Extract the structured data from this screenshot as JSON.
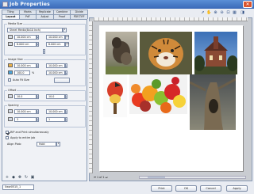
{
  "window": {
    "title": "Job Properties"
  },
  "tabs": {
    "row1": [
      "Tiling",
      "Marks",
      "Replicate",
      "Combine",
      "Divide"
    ],
    "row2": [
      "Layout",
      "PdF",
      "Adjust",
      "Proof",
      "PDF/TIFF"
    ]
  },
  "media_size": {
    "header": "Media Size",
    "selected": "Sheet Media(8x10 Inch)",
    "width": "10.000 cm",
    "height": "8.000 cm",
    "unit": "cm"
  },
  "image_size": {
    "header": "Image Size",
    "width": "10.000 cm",
    "height": "10.000 cm",
    "scale_a": "100.0",
    "scale_b": "100.0",
    "auto_fit_label": "Auto Fit Size",
    "pct": "%"
  },
  "offset": {
    "header": "Offset",
    "x": "10.0",
    "y": "10.0"
  },
  "spacing": {
    "header": "Spacing",
    "x": "10.000 cm",
    "y": "10.000 cm",
    "count_a": "3",
    "count_b": "1"
  },
  "options": {
    "print_label": "RIP and Print simultaneously",
    "apply_label": "Apply to entire job",
    "align_label": "Align Plotc",
    "align_value": "Hold"
  },
  "left_bottom_icons": [
    "add-icon",
    "shape-icon",
    "move-icon",
    "rotate-icon",
    "crop-icon"
  ],
  "toolbar_icons": [
    "pointer-icon",
    "hand-icon",
    "zoom-in-icon",
    "zoom-out-icon",
    "fit-icon",
    "grid-icon",
    "ruler-icon"
  ],
  "pager": {
    "label": "1 of 1"
  },
  "footer": {
    "filename": "0ww0515_1",
    "buttons": {
      "print": "Print",
      "ok": "OK",
      "cancel": "Cancel",
      "apply": "Apply"
    }
  },
  "colors": {
    "title_bar": "#3a69b8",
    "panel": "#f0f2f6",
    "canvas": "#c9ccd1"
  }
}
